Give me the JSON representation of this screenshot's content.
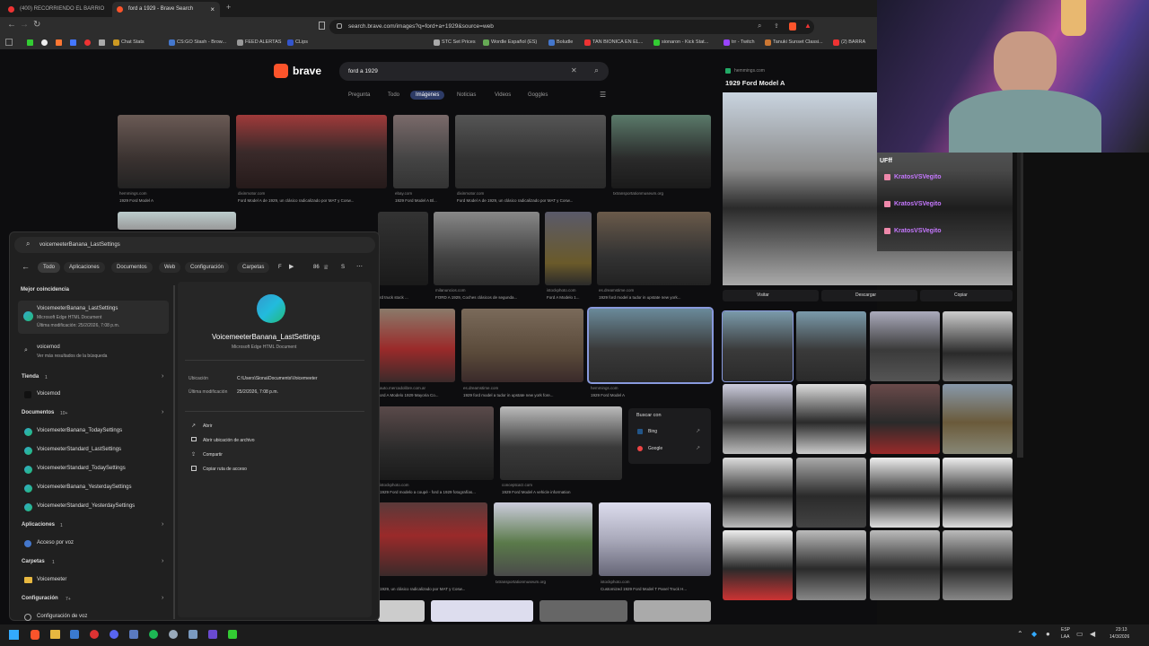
{
  "browser": {
    "tabs": [
      {
        "title": "(400) RECORRIENDO EL BARRIO MÁ..."
      },
      {
        "title": "ford a 1929 - Brave Search"
      }
    ],
    "url": "search.brave.com/images?q=ford+a+1929&source=web",
    "bookmarks": [
      "Chat Stats",
      "CS:GO Stash - Brow...",
      "FEED ALERTAS",
      "CLips",
      "STC Set Prices",
      "Wordle Español (ES)",
      "Boludle",
      "TAN BIONICA EN EL...",
      "sionaron - Kick Stat...",
      "trr - Twitch",
      "Tanuki Sunset Classi...",
      "(2) BARRA"
    ]
  },
  "search": {
    "brand": "brave",
    "query": "ford a 1929",
    "tabs": [
      "Pregunta",
      "Todo",
      "Imágenes",
      "Noticias",
      "Videos",
      "Goggles"
    ],
    "active_tab": "Imágenes",
    "results_row1": [
      {
        "source": "hemmings.com",
        "title": "1929 Ford Model A"
      },
      {
        "source": "dixinmotor.com",
        "title": "Ford Model A de 1929, un clásico radicalizado por MAT y Cosw..."
      },
      {
        "source": "ebay.com",
        "title": "1929 Ford Model A Bl..."
      },
      {
        "source": "dixinmotor.com",
        "title": "Ford Model A de 1929, un clásico radicalizado por MAT y Cosw..."
      },
      {
        "source": "txtransportationmuseum.org",
        "title": ""
      }
    ],
    "results_row2": [
      {
        "source": "",
        "title": "rd truck stock ..."
      },
      {
        "source": "milanuncios.com",
        "title": "FORD A 1929, Coches clásicos de segunda..."
      },
      {
        "source": "istockphoto.com",
        "title": "Ford A Modelo 1..."
      },
      {
        "source": "es.dreamstime.com",
        "title": "1929 ford model a tudor in upstate new york..."
      }
    ],
    "results_row3": [
      {
        "source": "auto.mercadolibre.com.ar",
        "title": "ord A Modelo 1929 Mayoria Co..."
      },
      {
        "source": "es.dreamstime.com",
        "title": "1929 ford model a tudor in upstate new york fore..."
      },
      {
        "source": "hemmings.com",
        "title": "1929 Ford Model A"
      }
    ],
    "results_row4": [
      {
        "source": "istockphoto.com",
        "title": "1929 Ford modelo a coupé - ford a 1929 fotografías..."
      },
      {
        "source": "conceptcarz.com",
        "title": "1929 Ford Model A vehicle information"
      }
    ],
    "results_row5": [
      {
        "source": "",
        "title": "1929, un clásico radicalizado por MAT y Cosw..."
      },
      {
        "source": "txtransportationmuseum.org",
        "title": ""
      },
      {
        "source": "istockphoto.com",
        "title": "Customized 1929 Ford Model T Panel Truck H..."
      }
    ],
    "search_with": {
      "title": "Buscar con",
      "options": [
        "Bing",
        "Google"
      ]
    }
  },
  "preview_panel": {
    "source": "hemmings.com",
    "title": "1929 Ford Model A",
    "actions": [
      "Visitar",
      "Descargar",
      "Copiar"
    ]
  },
  "start_menu": {
    "query": "voicemeeterBanana_LastSettings",
    "filters": [
      "Todo",
      "Aplicaciones",
      "Documentos",
      "Web",
      "Configuración",
      "Carpetas",
      "F"
    ],
    "active_filter": "Todo",
    "count": "86",
    "extra_letter": "S",
    "best_match_header": "Mejor coincidencia",
    "best_match": {
      "name": "VoicemeeterBanana_LastSettings",
      "type": "Microsoft Edge HTML Document",
      "modified": "Última modificación: 25/2/2026, 7:08 p.m."
    },
    "web_item": {
      "name": "voicemod",
      "sub": "Ver más resultados de la búsqueda"
    },
    "store_header": "Tienda",
    "store_count": "1",
    "store_items": [
      "Voicemod"
    ],
    "docs_header": "Documentos",
    "docs_count": "10+",
    "docs_items": [
      "VoicemeeterBanana_TodaySettings",
      "VoicemeeterStandard_LastSettings",
      "VoicemeeterStandard_TodaySettings",
      "VoicemeeterBanana_YesterdaySettings",
      "VoicemeeterStandard_YesterdaySettings"
    ],
    "apps_header": "Aplicaciones",
    "apps_count": "1",
    "apps_items": [
      "Acceso por voz"
    ],
    "folders_header": "Carpetas",
    "folders_count": "1",
    "folders_items": [
      "Voicemeeter"
    ],
    "config_header": "Configuración",
    "config_count": "7+",
    "config_items": [
      "Configuración de voz"
    ],
    "detail": {
      "name": "VoicemeeterBanana_LastSettings",
      "type": "Microsoft Edge HTML Document",
      "location_label": "Ubicación",
      "location": "C:\\Users\\Siona\\Documents\\Voicemeeter",
      "modified_label": "Última modificación",
      "modified": "25/2/2026, 7:08 p.m.",
      "actions": [
        "Abrir",
        "Abrir ubicación de archivo",
        "Compartir",
        "Copiar ruta de acceso"
      ]
    }
  },
  "stream_overlay": {
    "chat_user": "UFff",
    "messages": [
      "KratosVSVegito",
      "KratosVSVegito",
      "KratosVSVegito"
    ]
  },
  "taskbar": {
    "lang": "ESP",
    "lang_sub": "LAA",
    "time": "23:13",
    "date": "14/3/2026"
  }
}
